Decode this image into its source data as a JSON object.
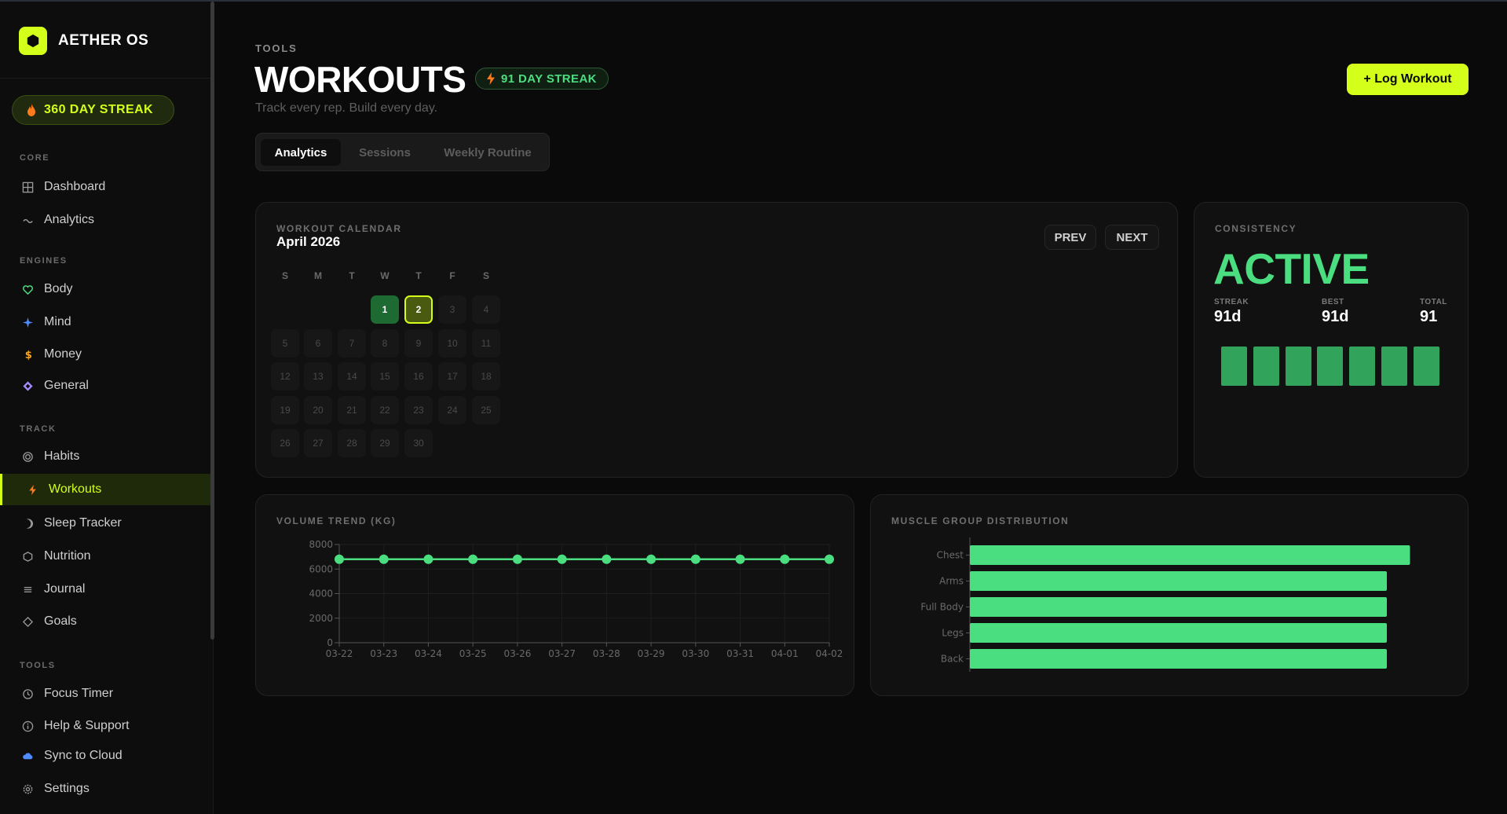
{
  "brand": {
    "name": "AETHER OS"
  },
  "sidebar": {
    "streak": "360 DAY STREAK",
    "sections": [
      {
        "label": "CORE",
        "items": [
          {
            "label": "Dashboard",
            "icon": "grid-icon"
          },
          {
            "label": "Analytics",
            "icon": "wave-icon"
          }
        ]
      },
      {
        "label": "ENGINES",
        "items": [
          {
            "label": "Body",
            "icon": "heart-icon"
          },
          {
            "label": "Mind",
            "icon": "sparkle-icon"
          },
          {
            "label": "Money",
            "icon": "dollar-icon"
          },
          {
            "label": "General",
            "icon": "diamond-icon"
          }
        ]
      },
      {
        "label": "TRACK",
        "items": [
          {
            "label": "Habits",
            "icon": "target-icon"
          },
          {
            "label": "Workouts",
            "icon": "bolt-icon",
            "active": true
          },
          {
            "label": "Sleep Tracker",
            "icon": "moon-icon"
          },
          {
            "label": "Nutrition",
            "icon": "hexagon-icon"
          },
          {
            "label": "Journal",
            "icon": "lines-icon"
          },
          {
            "label": "Goals",
            "icon": "diamond-outline-icon"
          }
        ]
      },
      {
        "label": "TOOLS",
        "items": [
          {
            "label": "Focus Timer",
            "icon": "clock-icon"
          },
          {
            "label": "Help & Support",
            "icon": "info-icon"
          },
          {
            "label": "Sync to Cloud",
            "icon": "cloud-icon"
          },
          {
            "label": "Settings",
            "icon": "gear-icon"
          }
        ]
      }
    ]
  },
  "header": {
    "crumb": "TOOLS",
    "title": "WORKOUTS",
    "badge": "91 DAY STREAK",
    "subtitle": "Track every rep. Build every day.",
    "log_button": "+ Log Workout"
  },
  "tabs": [
    {
      "label": "Analytics",
      "active": true
    },
    {
      "label": "Sessions"
    },
    {
      "label": "Weekly Routine"
    }
  ],
  "calendar": {
    "label": "WORKOUT CALENDAR",
    "month": "April 2026",
    "prev": "PREV",
    "next": "NEXT",
    "weekdays": [
      "S",
      "M",
      "T",
      "W",
      "T",
      "F",
      "S"
    ],
    "first_weekday": 3,
    "days_in_month": 30,
    "completed_days": [
      1
    ],
    "today": 2
  },
  "consistency": {
    "label": "CONSISTENCY",
    "status": "ACTIVE",
    "stats": [
      {
        "label": "STREAK",
        "value": "91d"
      },
      {
        "label": "BEST",
        "value": "91d"
      },
      {
        "label": "TOTAL",
        "value": "91"
      }
    ],
    "week_bars": 7
  },
  "colors": {
    "accent": "#d4ff1a",
    "green": "#4ade80",
    "bar_green": "#31a35a",
    "bg": "#0a0a0a"
  },
  "chart_data": [
    {
      "type": "line",
      "title": "VOLUME TREND (KG)",
      "x": [
        "03-22",
        "03-23",
        "03-24",
        "03-25",
        "03-26",
        "03-27",
        "03-28",
        "03-29",
        "03-30",
        "03-31",
        "04-01",
        "04-02"
      ],
      "series": [
        {
          "values": [
            6800,
            6800,
            6800,
            6800,
            6800,
            6800,
            6800,
            6800,
            6800,
            6800,
            6800,
            6800
          ]
        }
      ],
      "yticks": [
        0,
        2000,
        4000,
        6000,
        8000
      ],
      "ylim": [
        0,
        8000
      ],
      "grid": true
    },
    {
      "type": "bar",
      "orientation": "horizontal",
      "title": "MUSCLE GROUP DISTRIBUTION",
      "categories": [
        "Chest",
        "Arms",
        "Full Body",
        "Legs",
        "Back"
      ],
      "values": [
        19,
        18,
        18,
        18,
        18
      ],
      "xlim": [
        0,
        20
      ]
    }
  ]
}
